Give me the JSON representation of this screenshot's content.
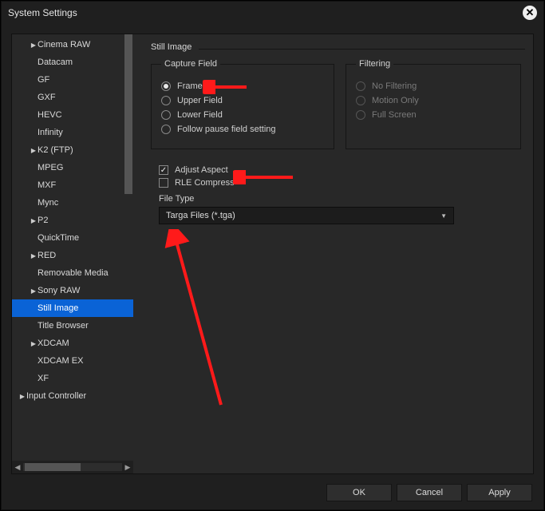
{
  "window": {
    "title": "System Settings"
  },
  "sidebar": {
    "items": [
      {
        "label": "Cinema RAW",
        "expandable": true,
        "depth": 1
      },
      {
        "label": "Datacam",
        "expandable": false,
        "depth": 1
      },
      {
        "label": "GF",
        "expandable": false,
        "depth": 1
      },
      {
        "label": "GXF",
        "expandable": false,
        "depth": 1
      },
      {
        "label": "HEVC",
        "expandable": false,
        "depth": 1
      },
      {
        "label": "Infinity",
        "expandable": false,
        "depth": 1
      },
      {
        "label": "K2 (FTP)",
        "expandable": true,
        "depth": 1
      },
      {
        "label": "MPEG",
        "expandable": false,
        "depth": 1
      },
      {
        "label": "MXF",
        "expandable": false,
        "depth": 1
      },
      {
        "label": "Mync",
        "expandable": false,
        "depth": 1
      },
      {
        "label": "P2",
        "expandable": true,
        "depth": 1
      },
      {
        "label": "QuickTime",
        "expandable": false,
        "depth": 1
      },
      {
        "label": "RED",
        "expandable": true,
        "depth": 1
      },
      {
        "label": "Removable Media",
        "expandable": false,
        "depth": 1
      },
      {
        "label": "Sony RAW",
        "expandable": true,
        "depth": 1
      },
      {
        "label": "Still Image",
        "expandable": false,
        "depth": 1,
        "selected": true
      },
      {
        "label": "Title Browser",
        "expandable": false,
        "depth": 1
      },
      {
        "label": "XDCAM",
        "expandable": true,
        "depth": 1
      },
      {
        "label": "XDCAM EX",
        "expandable": false,
        "depth": 1
      },
      {
        "label": "XF",
        "expandable": false,
        "depth": 1
      },
      {
        "label": "Input Controller",
        "expandable": true,
        "depth": 0
      }
    ]
  },
  "page": {
    "title": "Still Image",
    "capture_field": {
      "legend": "Capture Field",
      "options": {
        "frame": "Frame",
        "upper": "Upper Field",
        "lower": "Lower Field",
        "follow": "Follow pause field setting"
      },
      "selected": "frame"
    },
    "filtering": {
      "legend": "Filtering",
      "options": {
        "none": "No Filtering",
        "motion": "Motion Only",
        "full": "Full Screen"
      },
      "disabled": true
    },
    "adjust_aspect": {
      "label": "Adjust Aspect",
      "checked": true
    },
    "rle_compress": {
      "label": "RLE Compress",
      "checked": false
    },
    "file_type": {
      "label": "File Type",
      "value": "Targa Files (*.tga)"
    }
  },
  "footer": {
    "ok": "OK",
    "cancel": "Cancel",
    "apply": "Apply"
  }
}
